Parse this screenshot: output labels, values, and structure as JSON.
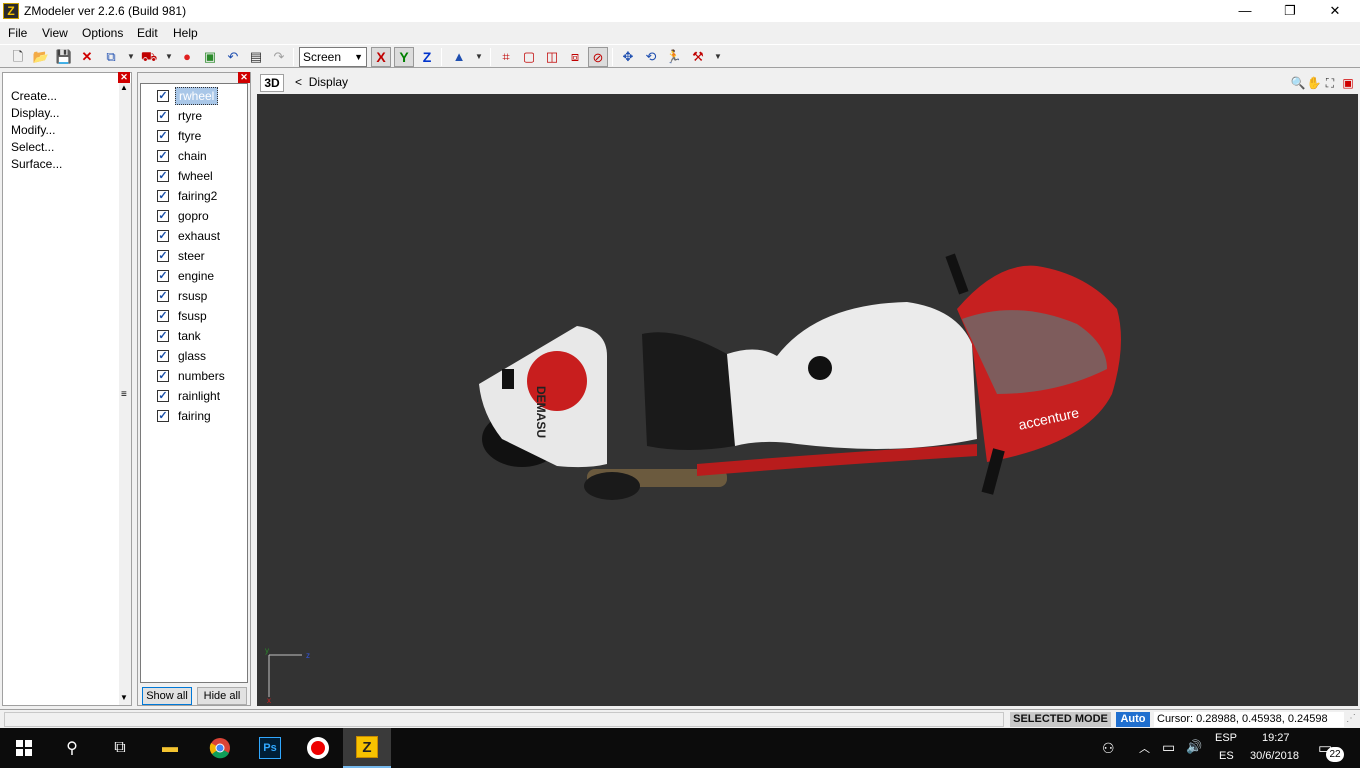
{
  "window": {
    "title": "ZModeler ver 2.2.6 (Build 981)",
    "app_icon_letter": "Z",
    "controls": {
      "minimize": "—",
      "maximize": "❐",
      "close": "✕"
    }
  },
  "menu": {
    "items": [
      "File",
      "View",
      "Options",
      "Edit",
      "Help"
    ]
  },
  "toolbar": {
    "screen_select": "Screen",
    "axes": {
      "x": "X",
      "y": "Y",
      "z": "Z"
    },
    "colors": {
      "x": "#c00000",
      "y": "#008000",
      "z": "#0033cc"
    }
  },
  "left_panel": {
    "items": [
      "Create...",
      "Display...",
      "Modify...",
      "Select...",
      "Surface..."
    ]
  },
  "objects": {
    "items": [
      "rwheel",
      "rtyre",
      "ftyre",
      "chain",
      "fwheel",
      "fairing2",
      "gopro",
      "exhaust",
      "steer",
      "engine",
      "rsusp",
      "fsusp",
      "tank",
      "glass",
      "numbers",
      "rainlight",
      "fairing"
    ],
    "selected": "rwheel",
    "show_all": "Show all",
    "hide_all": "Hide all"
  },
  "viewport": {
    "mode_label": "3D",
    "breadcrumb_back": "<",
    "breadcrumb": "Display",
    "background": "#333333",
    "model": {
      "tank_text": "accenture",
      "tail_text": "DEMASU"
    },
    "gizmo": {
      "x": "x",
      "y": "y",
      "z": "z"
    }
  },
  "status": {
    "mode": "SELECTED MODE",
    "auto": "Auto",
    "cursor": "Cursor: 0.28988, 0.45938, 0.24598"
  },
  "taskbar": {
    "tray_lang_top": "ESP",
    "tray_lang_bottom": "ES",
    "time": "19:27",
    "date": "30/6/2018",
    "notifications": "22"
  }
}
